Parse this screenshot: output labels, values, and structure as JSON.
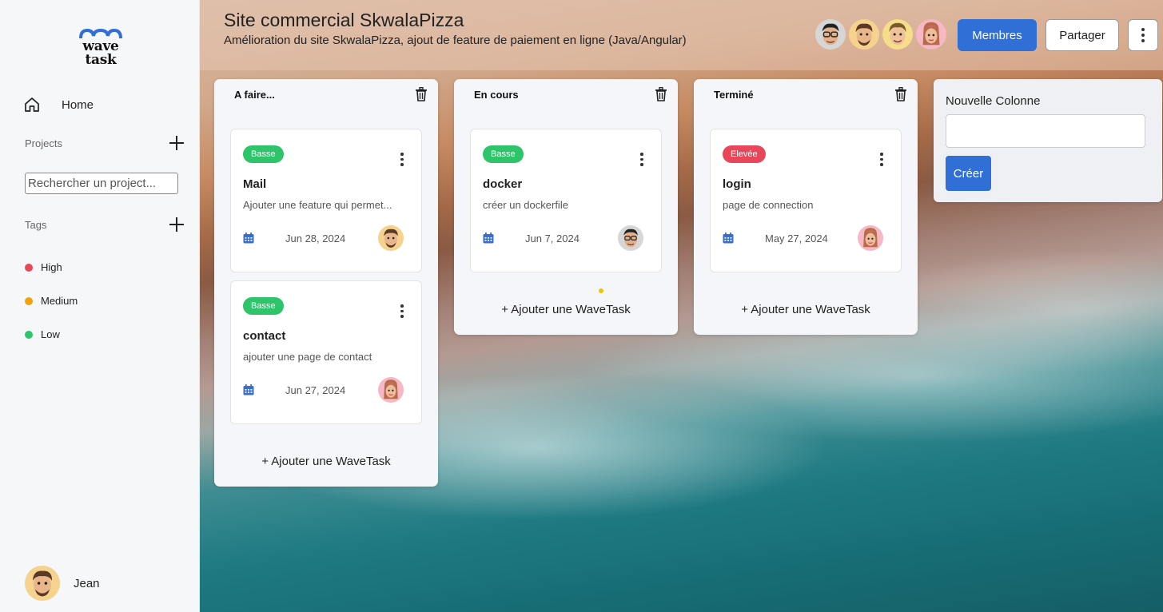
{
  "app": {
    "logo_line1": "wave",
    "logo_line2": "task",
    "brand_color": "#2f6fd6"
  },
  "sidebar": {
    "home_label": "Home",
    "projects_label": "Projects",
    "search_placeholder": "Rechercher un project...",
    "tags_label": "Tags",
    "tags": [
      {
        "label": "High",
        "color": "#e8475a"
      },
      {
        "label": "Medium",
        "color": "#f0a30a"
      },
      {
        "label": "Low",
        "color": "#2ec46a"
      }
    ],
    "user_name": "Jean"
  },
  "header": {
    "title": "Site commercial SkwalaPizza",
    "description": "Amélioration du site SkwalaPizza, ajout de feature de paiement en ligne (Java/Angular)",
    "members_button": "Membres",
    "share_button": "Partager",
    "member_avatars": [
      "avatar-man-glasses-icon",
      "avatar-man-beard-icon",
      "avatar-man-blond-icon",
      "avatar-woman-icon"
    ]
  },
  "columns": [
    {
      "title": "A faire...",
      "add_label": "+ Ajouter une WaveTask",
      "cards": [
        {
          "priority": "Basse",
          "priority_color": "#2ec46a",
          "title": "Mail",
          "description": "Ajouter une feature qui permet...",
          "date": "Jun 28, 2024",
          "assignee": "avatar-man-beard-icon"
        },
        {
          "priority": "Basse",
          "priority_color": "#2ec46a",
          "title": "contact",
          "description": "ajouter une page de contact",
          "date": "Jun 27, 2024",
          "assignee": "avatar-woman-icon"
        }
      ]
    },
    {
      "title": "En cours",
      "add_label": "+ Ajouter une WaveTask",
      "cards": [
        {
          "priority": "Basse",
          "priority_color": "#2ec46a",
          "title": "docker",
          "description": "créer un dockerfile",
          "date": "Jun 7, 2024",
          "assignee": "avatar-man-glasses-icon"
        }
      ]
    },
    {
      "title": "Terminé",
      "add_label": "+ Ajouter une WaveTask",
      "cards": [
        {
          "priority": "Elevée",
          "priority_color": "#e8475a",
          "title": "login",
          "description": "page de connection",
          "date": "May 27, 2024",
          "assignee": "avatar-woman-icon"
        }
      ]
    }
  ],
  "new_column": {
    "label": "Nouvelle Colonne",
    "input_value": "",
    "create_button": "Créer"
  }
}
